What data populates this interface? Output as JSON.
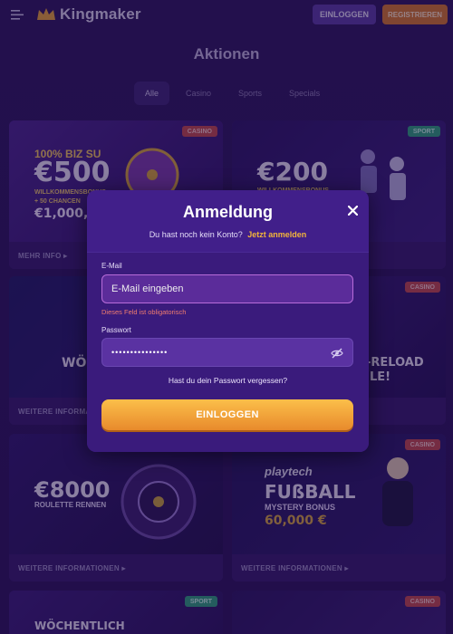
{
  "header": {
    "brand": "Kingmaker",
    "login_label": "EINLOGGEN",
    "register_label": "REGISTRIEREN"
  },
  "page": {
    "title": "Aktionen",
    "tabs": [
      {
        "label": "Alle",
        "active": true
      },
      {
        "label": "Casino",
        "active": false
      },
      {
        "label": "Sports",
        "active": false
      },
      {
        "label": "Specials",
        "active": false
      }
    ]
  },
  "cards": [
    {
      "tag": "CASINO",
      "headline": "100% BIZ SU",
      "big": "€500",
      "line1": "WILLKOMMENSBONUS",
      "line2": "+ 50 CHANCEN",
      "line3": "€1,000,",
      "footer": "MEHR INFO ▸"
    },
    {
      "tag": "SPORT",
      "big": "€200",
      "line1": "WILLKOMMENSBONUS",
      "footer": ""
    },
    {
      "tag": "",
      "big": "WÖ",
      "footer": "WEITERE INFORMATIONEN ▸"
    },
    {
      "tag": "CASINO",
      "big": "-RELOAD",
      "line1": "LE!",
      "footer": ""
    },
    {
      "tag": "",
      "big": "€8000",
      "line1": "ROULETTE RENNEN",
      "footer": "WEITERE INFORMATIONEN ▸"
    },
    {
      "tag": "CASINO",
      "brand": "playtech",
      "big": "FUßBALL",
      "line1": "MYSTERY BONUS",
      "line2": "60,000 €",
      "footer": "WEITERE INFORMATIONEN ▸"
    },
    {
      "tag": "SPORT",
      "big": "WÖCHENTLICH",
      "footer": ""
    },
    {
      "tag": "CASINO",
      "footer": ""
    }
  ],
  "modal": {
    "title": "Anmeldung",
    "no_account_text": "Du hast noch kein Konto?",
    "register_link": "Jetzt anmelden",
    "email_label": "E-Mail",
    "email_placeholder": "E-Mail eingeben",
    "email_error": "Dieses Feld ist obligatorisch",
    "password_label": "Passwort",
    "password_value": "•••••••••••••••",
    "forgot_password": "Hast du dein Passwort vergessen?",
    "submit_label": "EINLOGGEN"
  },
  "colors": {
    "accent_orange": "#f3b53a",
    "error": "#f07c6e",
    "modal_bg": "#411f8a"
  }
}
